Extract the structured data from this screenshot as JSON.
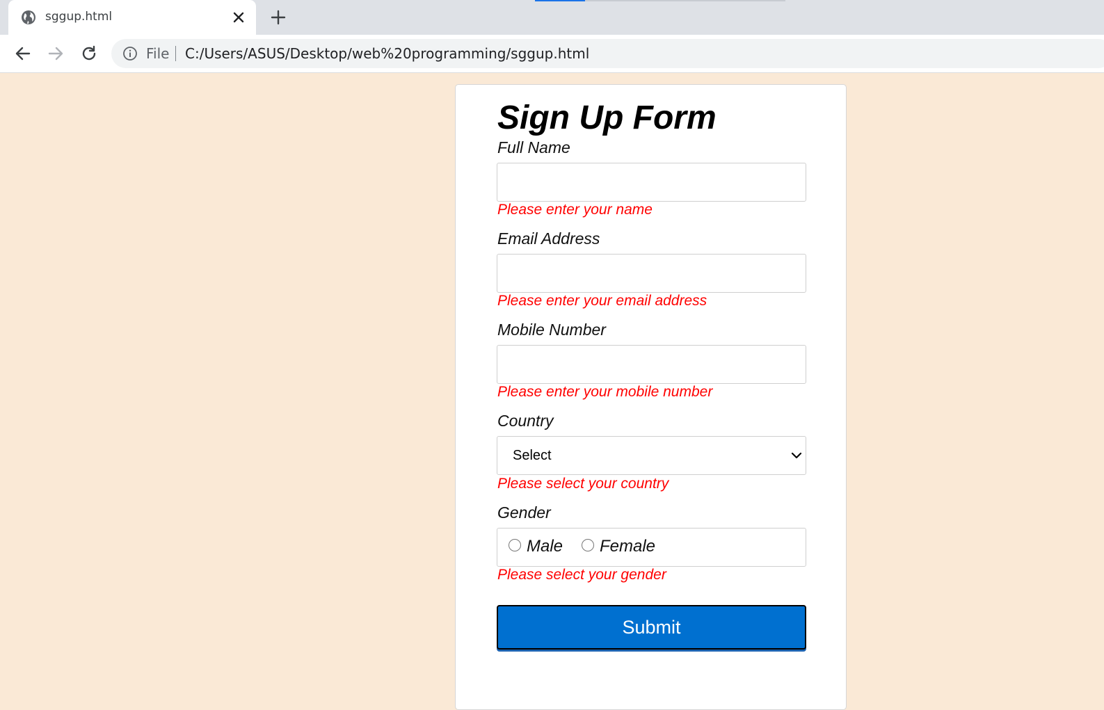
{
  "browser": {
    "tab_title": "sggup.html",
    "file_label": "File",
    "url": "C:/Users/ASUS/Desktop/web%20programming/sggup.html"
  },
  "form": {
    "title": "Sign Up Form",
    "full_name": {
      "label": "Full Name",
      "value": "",
      "error": "Please enter your name"
    },
    "email": {
      "label": "Email Address",
      "value": "",
      "error": "Please enter your email address"
    },
    "mobile": {
      "label": "Mobile Number",
      "value": "",
      "error": "Please enter your mobile number"
    },
    "country": {
      "label": "Country",
      "selected": "Select",
      "error": "Please select your country"
    },
    "gender": {
      "label": "Gender",
      "options": [
        {
          "label": "Male",
          "checked": false
        },
        {
          "label": "Female",
          "checked": false
        }
      ],
      "error": "Please select your gender"
    },
    "submit_label": "Submit"
  },
  "colors": {
    "page_background": "#fae9d6",
    "error_text": "#ff0000",
    "submit_background": "#0070d0",
    "loading_accent": "#1a73e8"
  }
}
